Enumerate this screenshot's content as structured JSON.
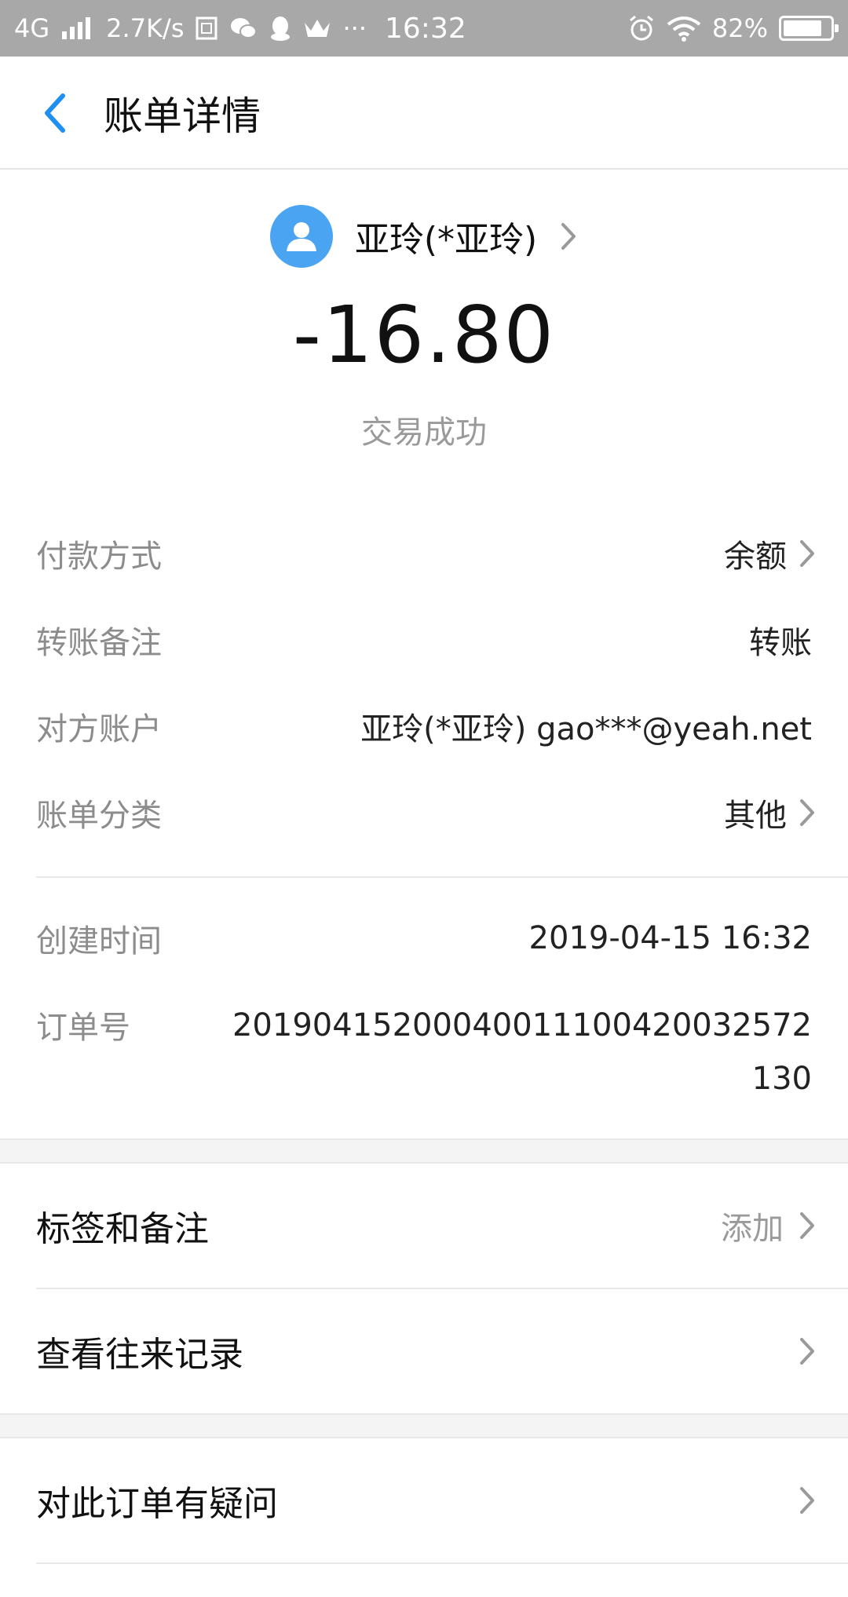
{
  "status_bar": {
    "network": "4G",
    "speed": "2.7K/s",
    "more": "···",
    "time": "16:32",
    "battery": "82%",
    "battery_level": 0.82
  },
  "nav": {
    "title": "账单详情"
  },
  "header": {
    "payee": "亚玲(*亚玲)",
    "amount": "-16.80",
    "status": "交易成功"
  },
  "details": {
    "payment_method_label": "付款方式",
    "payment_method_value": "余额",
    "remark_label": "转账备注",
    "remark_value": "转账",
    "counterparty_label": "对方账户",
    "counterparty_value": "亚玲(*亚玲) gao***@yeah.net",
    "category_label": "账单分类",
    "category_value": "其他",
    "created_label": "创建时间",
    "created_value": "2019-04-15 16:32",
    "order_label": "订单号",
    "order_value_line1": "201904152000400111004200325​72",
    "order_value_line2": "130"
  },
  "menu": {
    "tags_label": "标签和备注",
    "tags_action": "添加",
    "history_label": "查看往来记录",
    "question_label": "对此订单有疑问"
  },
  "colors": {
    "accent": "#1f8ff0",
    "avatar": "#4aa4f2",
    "statusbar": "#a8a8a8"
  }
}
